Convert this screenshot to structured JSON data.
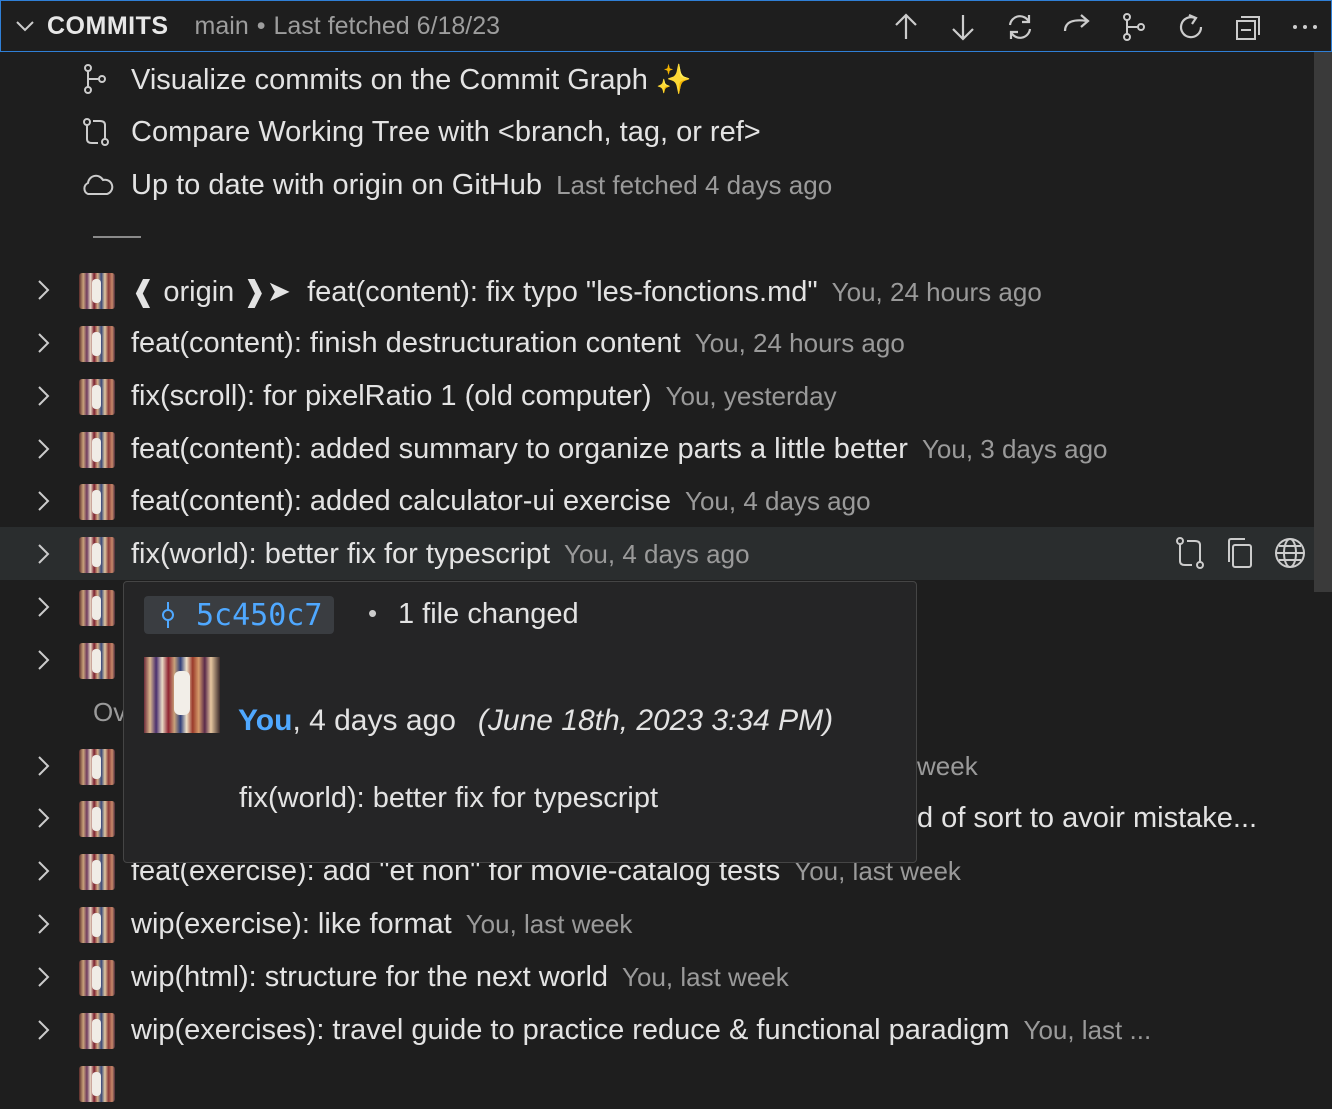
{
  "header": {
    "title": "COMMITS",
    "branch": "main",
    "separator": "•",
    "fetched": "Last fetched 6/18/23"
  },
  "info_rows": [
    {
      "label": "Visualize commits on the Commit Graph ✨",
      "meta": "",
      "icon": "commit-graph-icon"
    },
    {
      "label": "Compare Working Tree with <branch, tag, or ref>",
      "meta": "",
      "icon": "compare-icon"
    },
    {
      "label": "Up to date with origin on GitHub",
      "meta": "Last fetched 4 days ago",
      "icon": "cloud-icon"
    }
  ],
  "commits": [
    {
      "badge": "❰ origin ❱➤",
      "message": "feat(content): fix typo \"les-fonctions.md\"",
      "meta": "You, 24 hours ago"
    },
    {
      "message": "feat(content): finish destructuration content",
      "meta": "You, 24 hours ago"
    },
    {
      "message": "fix(scroll): for pixelRatio 1 (old computer)",
      "meta": "You, yesterday"
    },
    {
      "message": "feat(content): added summary to organize parts a little better",
      "meta": "You, 3 days ago"
    },
    {
      "message": "feat(content): added calculator-ui exercise",
      "meta": "You, 4 days ago"
    },
    {
      "message": "fix(world): better fix for typescript",
      "meta": "You, 4 days ago"
    },
    {
      "message": "",
      "meta": ""
    },
    {
      "message": "",
      "meta": ""
    },
    {
      "message": "",
      "meta": "week"
    },
    {
      "message": "",
      "meta": "d of sort to avoir mistake..."
    },
    {
      "message": "feat(exercise): add \"et non\" for movie-catalog tests",
      "meta": "You, last week"
    },
    {
      "message": "wip(exercise): like format",
      "meta": "You, last week"
    },
    {
      "message": "wip(html): structure for the next world",
      "meta": "You, last week"
    },
    {
      "message": "wip(exercises): travel guide to practice reduce & functional paradigm",
      "meta": "You, last ..."
    }
  ],
  "group_label": "Ov",
  "tooltip": {
    "sha": "5c450c7",
    "dot": "•",
    "files_changed": "1 file changed",
    "author": "You",
    "relative": ", 4 days ago",
    "date": "(June 18th, 2023 3:34 PM)",
    "message": "fix(world): better fix for typescript"
  }
}
